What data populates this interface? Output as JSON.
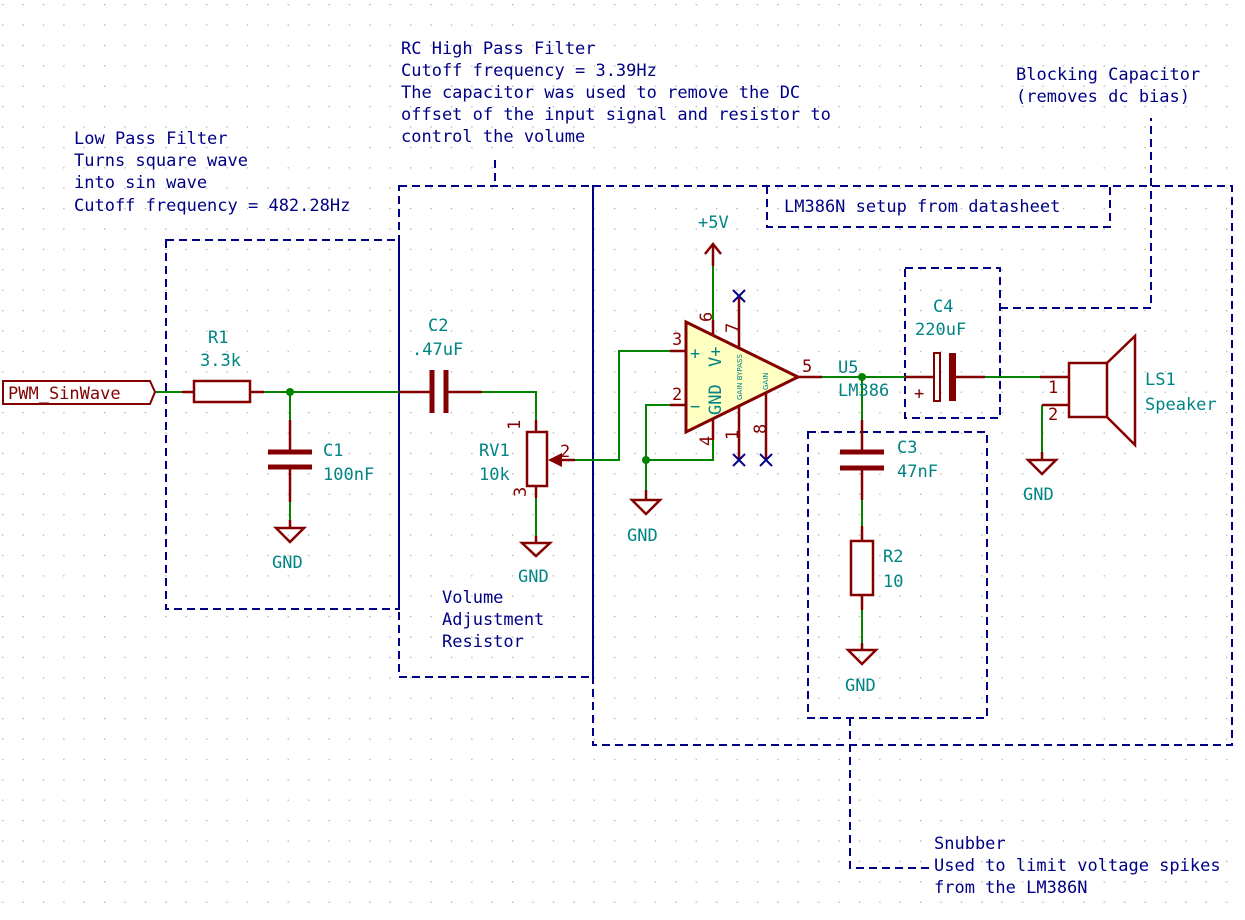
{
  "colors": {
    "background": "#ffffff",
    "grid_dot": "#b0b0b0",
    "note_text": "#000084",
    "reference_text": "#008484",
    "wire": "#008400",
    "component": "#840000",
    "opamp_fill": "#ffffc2"
  },
  "notes": {
    "low_pass": [
      "Low Pass Filter",
      "Turns square wave",
      "into sin wave",
      "Cutoff frequency = 482.28Hz"
    ],
    "high_pass": [
      "RC High Pass Filter",
      "Cutoff frequency = 3.39Hz",
      "The capacitor was used to remove the DC",
      "offset of the input signal and resistor to",
      "control the volume"
    ],
    "blocking": [
      "Blocking Capacitor",
      "(removes dc bias)"
    ],
    "lm386_setup": "LM386N setup from datasheet",
    "volume": [
      "Volume",
      "Adjustment",
      "Resistor"
    ],
    "snubber": [
      "Snubber",
      "Used to limit voltage spikes",
      "from the LM386N"
    ]
  },
  "input_label": "PWM_SinWave",
  "components": {
    "R1": {
      "ref": "R1",
      "value": "3.3k"
    },
    "C1": {
      "ref": "C1",
      "value": "100nF"
    },
    "C2": {
      "ref": "C2",
      "value": ".47uF"
    },
    "RV1": {
      "ref": "RV1",
      "value": "10k",
      "pins": [
        "1",
        "2",
        "3"
      ]
    },
    "U5": {
      "ref": "U5",
      "value": "LM386",
      "pins": [
        "3",
        "2",
        "6",
        "7",
        "4",
        "1",
        "8",
        "5"
      ],
      "inner": [
        "+",
        "−",
        "GND",
        "V+",
        "GAIN BYPASS",
        "GAIN"
      ]
    },
    "C3": {
      "ref": "C3",
      "value": "47nF"
    },
    "R2": {
      "ref": "R2",
      "value": "10"
    },
    "C4": {
      "ref": "C4",
      "value": "220uF",
      "polarity": "+"
    },
    "LS1": {
      "ref": "LS1",
      "value": "Speaker",
      "pins": [
        "1",
        "2"
      ]
    }
  },
  "power": {
    "vcc": "+5V",
    "gnd": "GND"
  }
}
